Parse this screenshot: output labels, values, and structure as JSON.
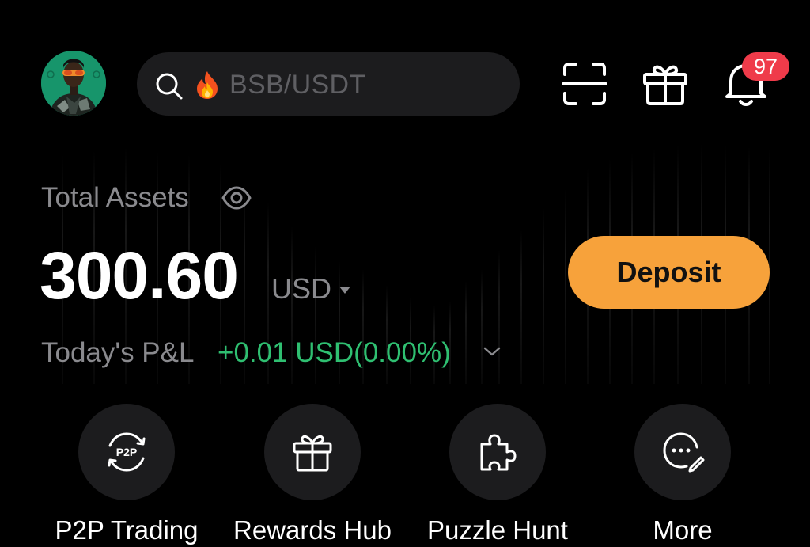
{
  "header": {
    "avatar": "avatar-image",
    "search": {
      "icon": "search-icon",
      "hot_icon": "fire-icon",
      "placeholder": "BSB/USDT"
    },
    "icons": [
      "scan-icon",
      "gift-icon",
      "bell-icon"
    ],
    "notification_count": "97"
  },
  "assets": {
    "label": "Total Assets",
    "visibility_icon": "eye-icon",
    "value": "300.60",
    "currency": "USD",
    "deposit_label": "Deposit",
    "pnl_label": "Today's P&L",
    "pnl_value": "+0.01 USD(0.00%)"
  },
  "actions": [
    {
      "label": "P2P Trading",
      "icon": "p2p-icon"
    },
    {
      "label": "Rewards Hub",
      "icon": "gift-icon"
    },
    {
      "label": "Puzzle Hunt",
      "icon": "puzzle-icon"
    },
    {
      "label": "More",
      "icon": "more-icon"
    }
  ],
  "colors": {
    "background": "#000000",
    "accent": "#f7a23b",
    "positive": "#2fbf71",
    "badge": "#ef3b4a",
    "muted_text": "#8a8a8e",
    "surface": "#1c1c1e"
  }
}
